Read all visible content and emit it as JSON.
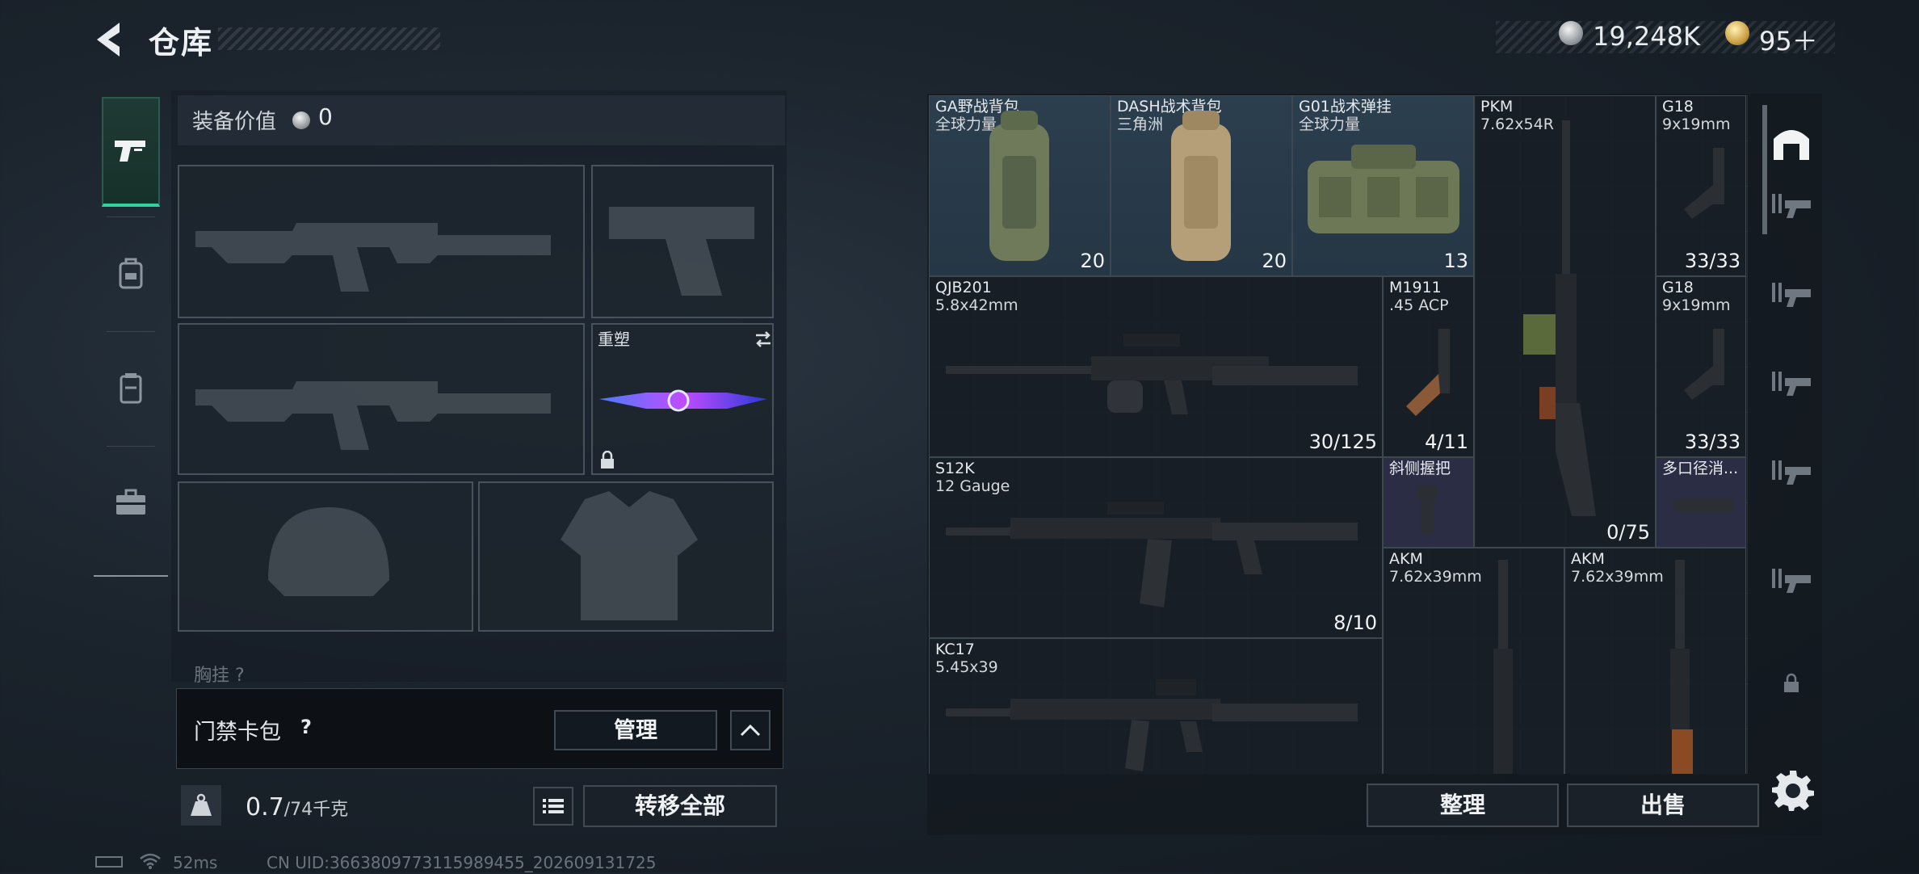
{
  "header": {
    "title": "仓库"
  },
  "currency": {
    "silver": "19,248K",
    "gold": "95＋"
  },
  "equipment": {
    "value_label": "装备价值",
    "value": "0",
    "skin_label": "重塑",
    "chest_label": "胸挂 ?"
  },
  "keycard": {
    "label": "门禁卡包",
    "help": "?",
    "manage": "管理"
  },
  "weight": {
    "current": "0.7",
    "max": "/74千克"
  },
  "actions": {
    "transfer_all": "转移全部",
    "sort": "整理",
    "sell": "出售"
  },
  "status": {
    "ping": "52ms",
    "uid": "CN UID:3663809773115989455_202609131725"
  },
  "inventory": [
    {
      "name": "GA野战背包",
      "sub": "全球力量",
      "count": "20",
      "kind": "bag"
    },
    {
      "name": "DASH战术背包",
      "sub": "三角洲",
      "count": "20",
      "kind": "bag"
    },
    {
      "name": "G01战术弹挂",
      "sub": "全球力量",
      "count": "13",
      "kind": "bag"
    },
    {
      "name": "PKM",
      "sub": "7.62x54R",
      "count": "0/75",
      "kind": "gun"
    },
    {
      "name": "G18",
      "sub": "9x19mm",
      "count": "33/33",
      "kind": "gun"
    },
    {
      "name": "QJB201",
      "sub": "5.8x42mm",
      "count": "30/125",
      "kind": "gun"
    },
    {
      "name": "M1911",
      "sub": ".45 ACP",
      "count": "4/11",
      "kind": "gun"
    },
    {
      "name": "G18",
      "sub": "9x19mm",
      "count": "33/33",
      "kind": "gun"
    },
    {
      "name": "S12K",
      "sub": "12 Gauge",
      "count": "8/10",
      "kind": "gun"
    },
    {
      "name": "斜侧握把",
      "sub": "",
      "count": "",
      "kind": "att"
    },
    {
      "name": "多口径消...",
      "sub": "",
      "count": "",
      "kind": "att"
    },
    {
      "name": "AKM",
      "sub": "7.62x39mm",
      "count": "",
      "kind": "gun"
    },
    {
      "name": "AKM",
      "sub": "7.62x39mm",
      "count": "",
      "kind": "gun"
    },
    {
      "name": "KC17",
      "sub": "5.45x39",
      "count": "",
      "kind": "gun"
    }
  ]
}
